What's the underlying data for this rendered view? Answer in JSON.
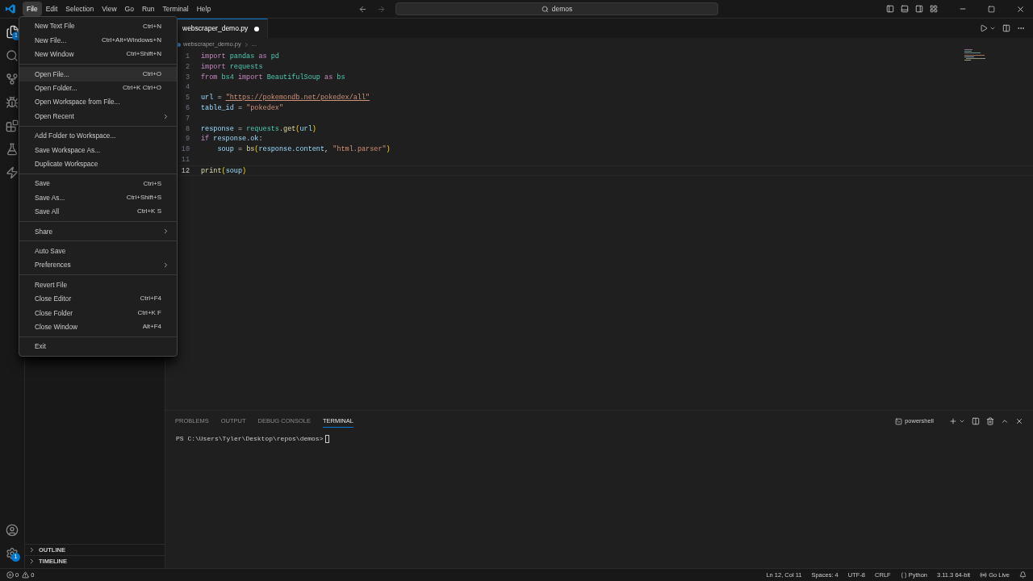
{
  "menubar": [
    {
      "label": "File",
      "selected": true
    },
    {
      "label": "Edit",
      "selected": false
    },
    {
      "label": "Selection",
      "selected": false
    },
    {
      "label": "View",
      "selected": false
    },
    {
      "label": "Go",
      "selected": false
    },
    {
      "label": "Run",
      "selected": false
    },
    {
      "label": "Terminal",
      "selected": false
    },
    {
      "label": "Help",
      "selected": false
    }
  ],
  "command_center": "demos",
  "activity_badges": {
    "explorer": "1",
    "settings": "1"
  },
  "file_menu": [
    [
      {
        "label": "New Text File",
        "shortcut": "Ctrl+N",
        "selected": false
      },
      {
        "label": "New File...",
        "shortcut": "Ctrl+Alt+Windows+N",
        "selected": false
      },
      {
        "label": "New Window",
        "shortcut": "Ctrl+Shift+N",
        "selected": false
      }
    ],
    [
      {
        "label": "Open File...",
        "shortcut": "Ctrl+O",
        "selected": true
      },
      {
        "label": "Open Folder...",
        "shortcut": "Ctrl+K Ctrl+O",
        "selected": false
      },
      {
        "label": "Open Workspace from File...",
        "selected": false
      },
      {
        "label": "Open Recent",
        "submenu": true,
        "selected": false
      }
    ],
    [
      {
        "label": "Add Folder to Workspace...",
        "selected": false
      },
      {
        "label": "Save Workspace As...",
        "selected": false
      },
      {
        "label": "Duplicate Workspace",
        "selected": false
      }
    ],
    [
      {
        "label": "Save",
        "shortcut": "Ctrl+S",
        "selected": false
      },
      {
        "label": "Save As...",
        "shortcut": "Ctrl+Shift+S",
        "selected": false
      },
      {
        "label": "Save All",
        "shortcut": "Ctrl+K S",
        "selected": false
      }
    ],
    [
      {
        "label": "Share",
        "submenu": true,
        "selected": false
      }
    ],
    [
      {
        "label": "Auto Save",
        "selected": false
      },
      {
        "label": "Preferences",
        "submenu": true,
        "selected": false
      }
    ],
    [
      {
        "label": "Revert File",
        "selected": false
      },
      {
        "label": "Close Editor",
        "shortcut": "Ctrl+F4",
        "selected": false
      },
      {
        "label": "Close Folder",
        "shortcut": "Ctrl+K F",
        "selected": false
      },
      {
        "label": "Close Window",
        "shortcut": "Alt+F4",
        "selected": false
      }
    ],
    [
      {
        "label": "Exit",
        "selected": false
      }
    ]
  ],
  "tabs": [
    {
      "label": "webscraper_demo.py",
      "selected": true,
      "modified": true
    }
  ],
  "breadcrumb": [
    "webscraper_demo.py",
    "..."
  ],
  "code": [
    {
      "number": "1",
      "current": false,
      "tokens": [
        {
          "kind": "keyword",
          "text": "import"
        },
        {
          "kind": "module",
          "text": " pandas"
        },
        {
          "kind": "keyword",
          "text": " as"
        },
        {
          "kind": "module",
          "text": " pd"
        }
      ]
    },
    {
      "number": "2",
      "current": false,
      "tokens": [
        {
          "kind": "keyword",
          "text": "import"
        },
        {
          "kind": "module",
          "text": " requests"
        }
      ]
    },
    {
      "number": "3",
      "current": false,
      "tokens": [
        {
          "kind": "keyword",
          "text": "from"
        },
        {
          "kind": "module",
          "text": " bs4"
        },
        {
          "kind": "keyword",
          "text": " import"
        },
        {
          "kind": "module",
          "text": " BeautifulSoup"
        },
        {
          "kind": "keyword",
          "text": " as"
        },
        {
          "kind": "module",
          "text": " bs"
        }
      ]
    },
    {
      "number": "4",
      "current": false
    },
    {
      "number": "5",
      "current": false,
      "tokens": [
        {
          "kind": "variable",
          "text": "url"
        },
        {
          "kind": "plain",
          "text": " = "
        },
        {
          "kind": "link",
          "text": "\"https://pokemondb.net/pokedex/all\""
        }
      ]
    },
    {
      "number": "6",
      "current": false,
      "tokens": [
        {
          "kind": "variable",
          "text": "table_id"
        },
        {
          "kind": "plain",
          "text": " = "
        },
        {
          "kind": "string",
          "text": "\"pokedex\""
        }
      ]
    },
    {
      "number": "7",
      "current": false
    },
    {
      "number": "8",
      "current": false,
      "tokens": [
        {
          "kind": "variable",
          "text": "response"
        },
        {
          "kind": "plain",
          "text": " = "
        },
        {
          "kind": "module",
          "text": "requests"
        },
        {
          "kind": "plain",
          "text": "."
        },
        {
          "kind": "function",
          "text": "get"
        },
        {
          "kind": "bracket",
          "text": "("
        },
        {
          "kind": "variable",
          "text": "url"
        },
        {
          "kind": "bracket",
          "text": ")"
        }
      ]
    },
    {
      "number": "9",
      "current": false,
      "tokens": [
        {
          "kind": "keyword",
          "text": "if"
        },
        {
          "kind": "variable",
          "text": " response"
        },
        {
          "kind": "plain",
          "text": "."
        },
        {
          "kind": "variable",
          "text": "ok"
        },
        {
          "kind": "plain",
          "text": ":"
        }
      ]
    },
    {
      "number": "10",
      "current": false,
      "tokens": [
        {
          "kind": "variable",
          "text": "    soup"
        },
        {
          "kind": "plain",
          "text": " = "
        },
        {
          "kind": "function",
          "text": "bs"
        },
        {
          "kind": "bracket",
          "text": "("
        },
        {
          "kind": "variable",
          "text": "response"
        },
        {
          "kind": "plain",
          "text": "."
        },
        {
          "kind": "variable",
          "text": "content"
        },
        {
          "kind": "plain",
          "text": ", "
        },
        {
          "kind": "string",
          "text": "\"html.parser\""
        },
        {
          "kind": "bracket",
          "text": ")"
        }
      ]
    },
    {
      "number": "11",
      "current": false
    },
    {
      "number": "12",
      "current": true,
      "tokens": [
        {
          "kind": "function",
          "text": "print"
        },
        {
          "kind": "bracket",
          "text": "("
        },
        {
          "kind": "variable",
          "text": "soup"
        },
        {
          "kind": "bracket",
          "text": ")"
        }
      ]
    }
  ],
  "sidebar_sections": [
    {
      "label": "OUTLINE",
      "expanded": false
    },
    {
      "label": "TIMELINE",
      "expanded": false
    }
  ],
  "panel_tabs": [
    {
      "label": "PROBLEMS",
      "selected": false
    },
    {
      "label": "OUTPUT",
      "selected": false
    },
    {
      "label": "DEBUG CONSOLE",
      "selected": false
    },
    {
      "label": "TERMINAL",
      "selected": true
    }
  ],
  "terminal_profile": "powershell",
  "terminal_prompt": "PS C:\\Users\\Tyler\\Desktop\\repos\\demos>",
  "status_bar": {
    "errors": "0",
    "warnings": "0",
    "items": [
      {
        "kind": "text",
        "text": "Ln 12, Col 11"
      },
      {
        "kind": "text",
        "text": "Spaces: 4"
      },
      {
        "kind": "text",
        "text": "UTF-8"
      },
      {
        "kind": "text",
        "text": "CRLF"
      },
      {
        "kind": "language",
        "text": "Python"
      },
      {
        "kind": "text",
        "text": "3.11.3 64-bit"
      },
      {
        "kind": "live",
        "text": "Go Live"
      }
    ]
  }
}
